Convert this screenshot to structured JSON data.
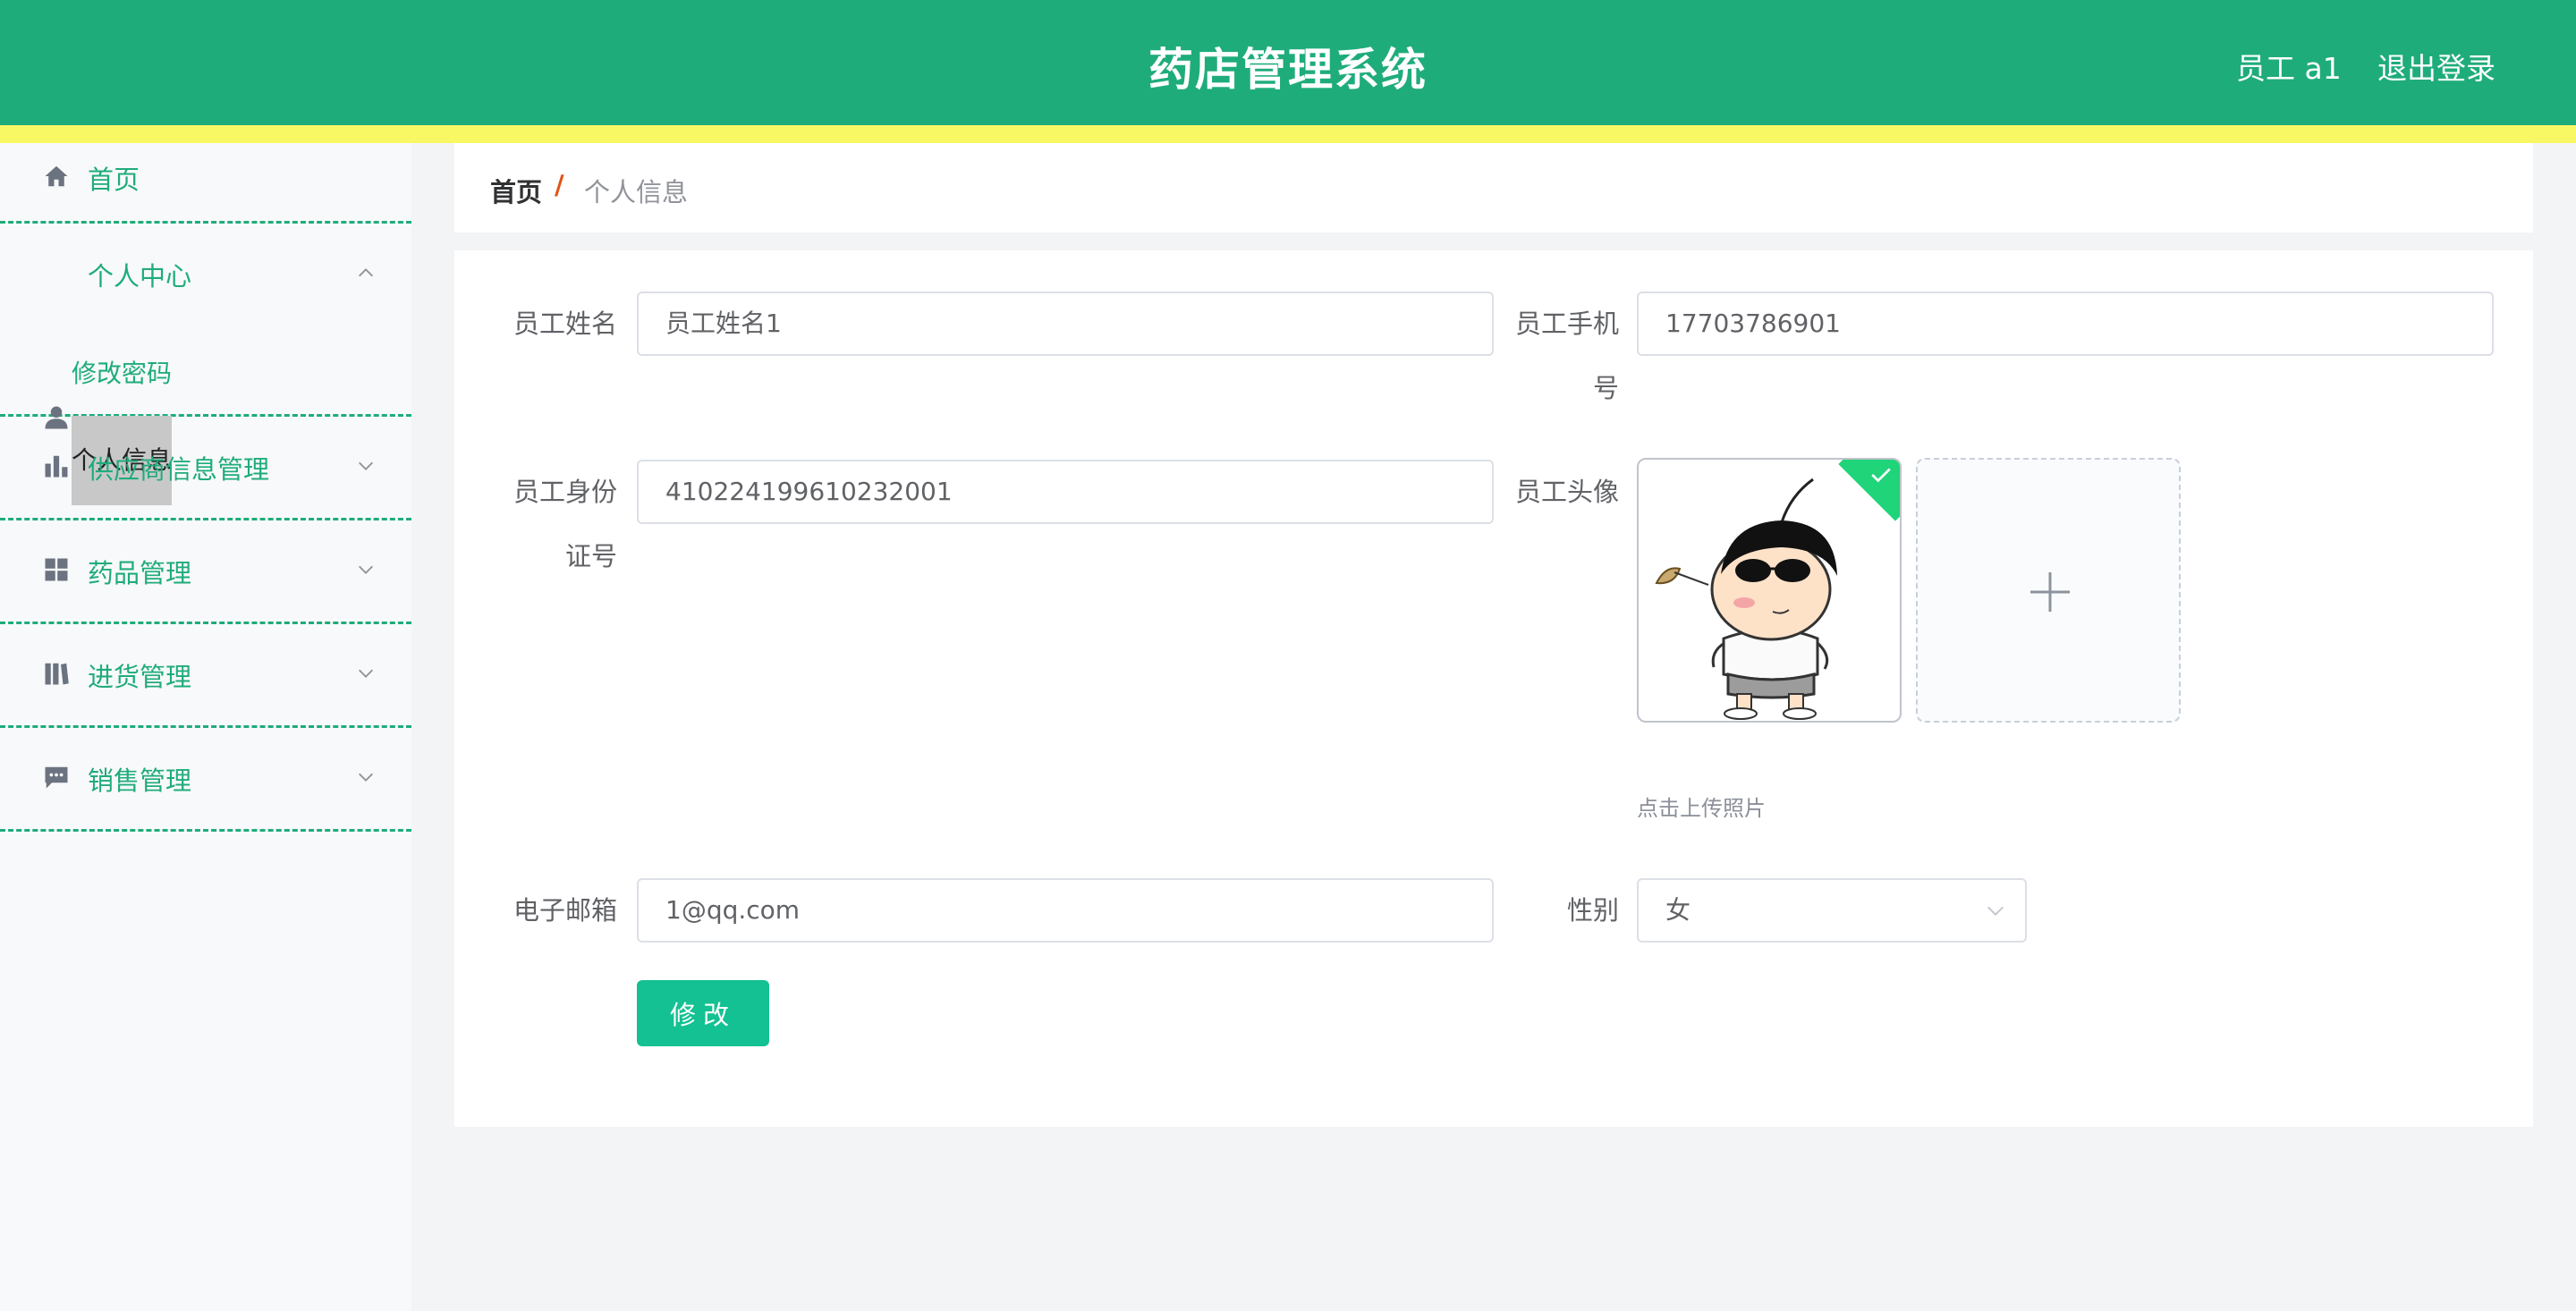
{
  "header": {
    "title": "药店管理系统",
    "user": "员工 a1",
    "logout": "退出登录"
  },
  "sidebar": {
    "items": [
      {
        "label": "首页",
        "icon": "home-icon"
      },
      {
        "label": "个人中心",
        "icon": "user-icon",
        "expanded": true,
        "children": [
          "修改密码",
          "个人信息"
        ]
      },
      {
        "label": "供应商信息管理",
        "icon": "bar-chart-icon"
      },
      {
        "label": "药品管理",
        "icon": "grid-icon"
      },
      {
        "label": "进货管理",
        "icon": "books-icon"
      },
      {
        "label": "销售管理",
        "icon": "message-icon"
      }
    ],
    "active_child": "个人信息"
  },
  "breadcrumb": {
    "home": "首页",
    "separator": "/",
    "current": "个人信息"
  },
  "form": {
    "name_label": "员工姓名",
    "name_value": "员工姓名1",
    "phone_label_line1": "员工手机",
    "phone_label_line2": "号",
    "phone_value": "17703786901",
    "id_label_line1": "员工身份",
    "id_label_line2": "证号",
    "id_value": "410224199610232001",
    "avatar_label": "员工头像",
    "upload_tip": "点击上传照片",
    "email_label": "电子邮箱",
    "email_value": "1@qq.com",
    "gender_label": "性别",
    "gender_value": "女",
    "submit_label": "修改"
  },
  "colors": {
    "primary": "#1fac7b",
    "stripe": "#f8f865",
    "button": "#13c192"
  }
}
